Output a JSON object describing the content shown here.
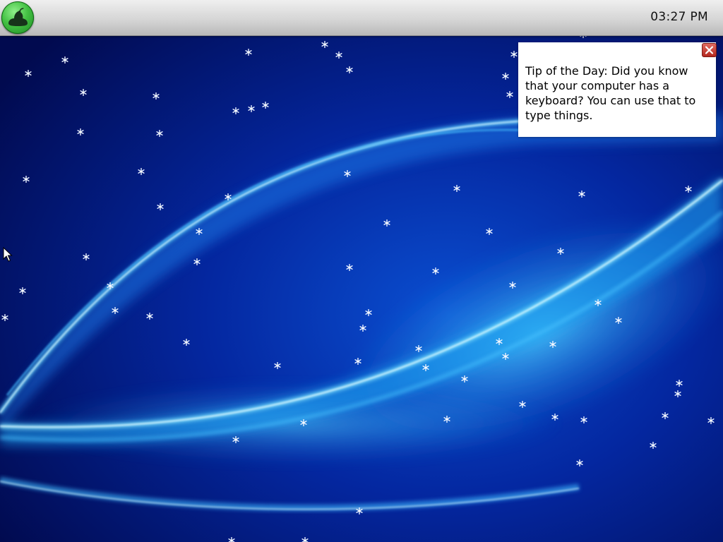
{
  "taskbar": {
    "clock": "03:27 PM"
  },
  "tip": {
    "text": "Tip of the Day: Did you know that your computer has a keyboard? You can use that to type things."
  },
  "icons": {
    "start": "pear-logo-icon",
    "close": "close-icon",
    "snowflake": "snowflake-icon",
    "cursor": "mouse-pointer-icon"
  },
  "colors": {
    "wallpaper_base": "#020c5c",
    "wallpaper_glow": "#2fb6f0",
    "start_green": "#43c043",
    "close_red": "#b3281f"
  }
}
